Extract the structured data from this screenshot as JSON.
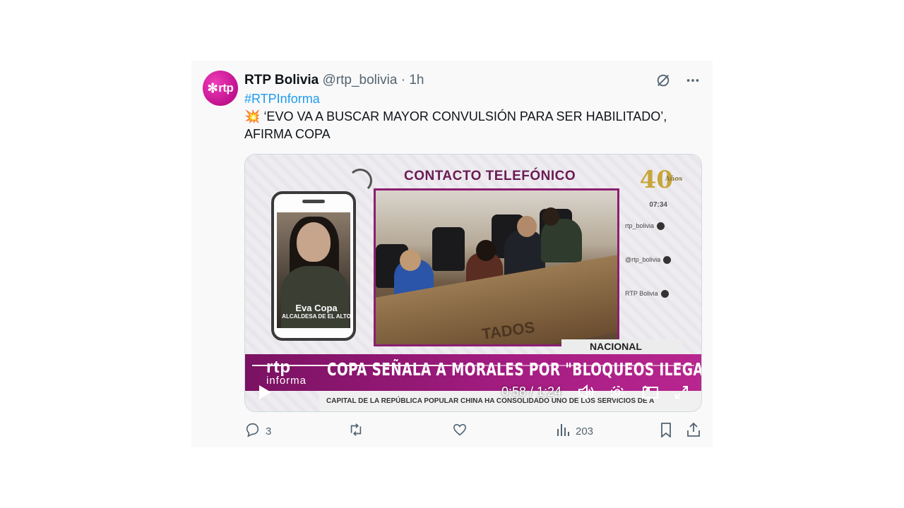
{
  "tweet": {
    "avatar_text": "rtp",
    "author_name": "RTP Bolivia",
    "handle": "@rtp_bolivia",
    "separator": "·",
    "time": "1h",
    "hashtag": "#RTPInforma",
    "emoji": "💥",
    "body": "‘EVO VA A BUSCAR MAYOR CONVULSIÓN PARA SER HABILITADO’, AFIRMA COPA"
  },
  "video": {
    "contact_title": "CONTACTO TELEFÓNICO",
    "phone_name": "Eva Copa",
    "phone_title": "ALCALDESA DE EL ALTO",
    "logo_number": "40",
    "logo_anos": "Años",
    "timecode": "07:34",
    "social": [
      "rtp_bolivia",
      "@rtp_bolivia",
      "RTP Bolivia"
    ],
    "desk_text": "TADOS",
    "nacional": "NACIONAL",
    "brand": "rtp",
    "brand_sub": "informa",
    "headline": "COPA SEÑALA A MORALES POR \"BLOQUEOS ILEGALES\"",
    "ticker": "CAPITAL DE LA REPÚBLICA POPULAR CHINA HA CONSOLIDADO UNO DE LOS SERVICIOS DE A",
    "current_time": "0:58 / 1:24",
    "progress": 0.45
  },
  "actions": {
    "replies": "3",
    "retweets": "",
    "likes": "",
    "views": "203"
  },
  "colors": {
    "link": "#1d9bf0",
    "muted": "#536471",
    "brand_magenta": "#a51d82"
  }
}
